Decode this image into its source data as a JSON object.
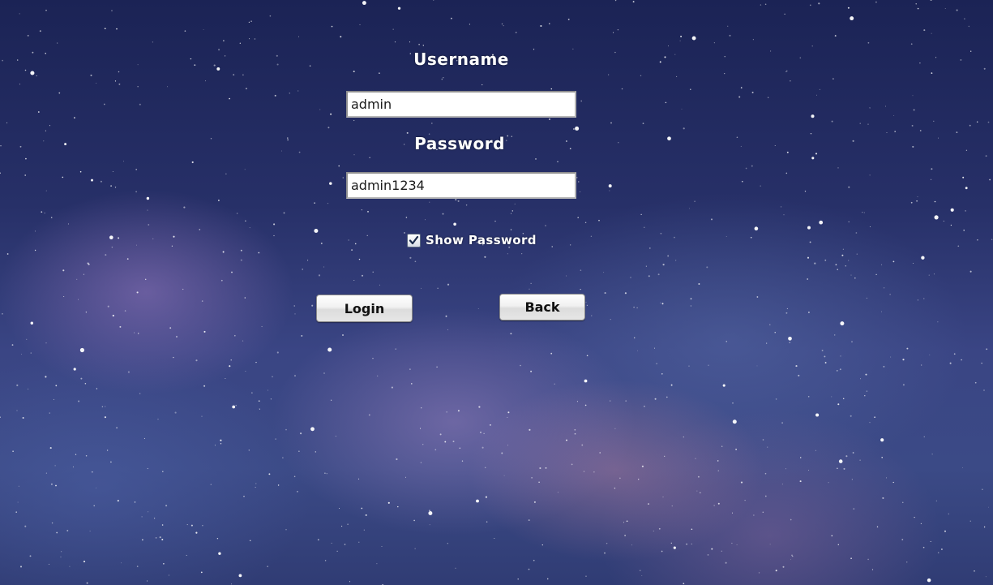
{
  "login_form": {
    "username_label": "Username",
    "username_value": "admin",
    "password_label": "Password",
    "password_value": "admin1234",
    "show_password_label": "Show Password",
    "show_password_checked": true,
    "login_button": "Login",
    "back_button": "Back"
  },
  "background": {
    "image": "starry night sky with milky way",
    "colors": [
      "#1b2355",
      "#3a4584",
      "#9c7fbf"
    ]
  }
}
